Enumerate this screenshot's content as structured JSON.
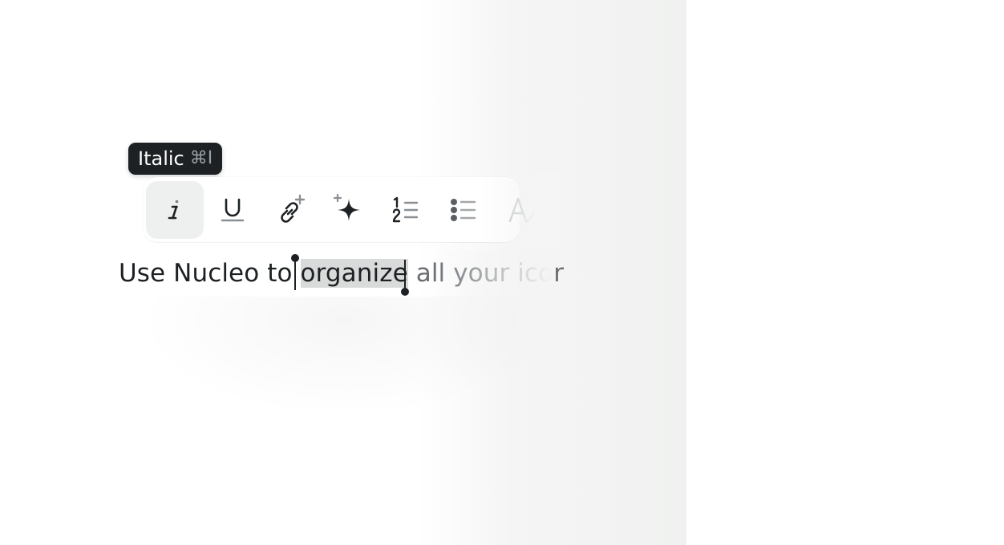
{
  "tooltip": {
    "label": "Italic",
    "shortcut": "⌘I"
  },
  "toolbar": {
    "buttons": [
      {
        "name": "italic",
        "icon": "italic-icon",
        "active": true
      },
      {
        "name": "underline",
        "icon": "underline-icon",
        "active": false
      },
      {
        "name": "add-link",
        "icon": "link-add-icon",
        "active": false
      },
      {
        "name": "ai-sparkle",
        "icon": "sparkle-icon",
        "active": false
      },
      {
        "name": "numbered-list",
        "icon": "numbered-list-icon",
        "active": false
      },
      {
        "name": "bulleted-list",
        "icon": "bulleted-list-icon",
        "active": false
      },
      {
        "name": "text-format",
        "icon": "text-format-icon",
        "active": false
      }
    ]
  },
  "editor": {
    "before_selection": "Use Nucleo to ",
    "selection": "organize",
    "after_selection": " all your icor"
  },
  "colors": {
    "text": "#1d2124",
    "tooltip_bg": "#1d2124",
    "selection_bg": "#d9dbda",
    "active_button_bg": "#eef0ef"
  }
}
